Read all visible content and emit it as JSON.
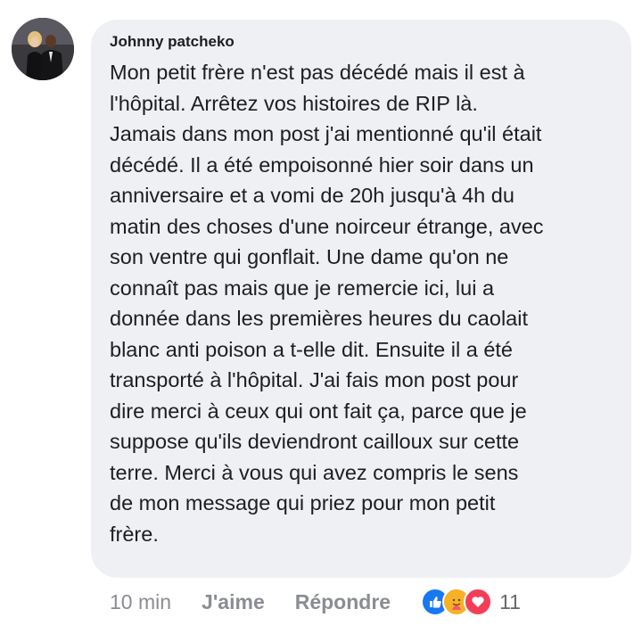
{
  "comment": {
    "author": "Johnny patcheko",
    "lines": [
      "Mon petit frère n'est pas décédé mais il est à",
      "l'hôpital. Arrêtez vos histoires de RIP là.",
      "Jamais dans mon post j'ai mentionné qu'il était",
      "décédé. Il a été empoisonné hier soir dans un",
      "anniversaire et a vomi de 20h jusqu'à 4h du",
      "matin des choses d'une noirceur étrange, avec",
      "son ventre qui gonflait. Une dame qu'on ne",
      "connaît pas mais que je remercie ici, lui a",
      "donnée dans les premières heures du caolait",
      "blanc anti poison a t-elle dit. Ensuite il a été",
      "transporté à l'hôpital. J'ai fais mon post pour",
      "dire merci à ceux qui ont fait ça, parce que je",
      "suppose qu'ils deviendront cailloux sur cette",
      "terre.  Merci à vous qui avez compris le sens",
      "de mon message qui priez pour mon petit",
      "frère."
    ]
  },
  "actions": {
    "time": "10 min",
    "like_label": "J'aime",
    "reply_label": "Répondre",
    "reaction_count": "11",
    "reactions": [
      "like-icon",
      "care-icon",
      "love-icon"
    ]
  },
  "colors": {
    "bubble": "#eff0f3",
    "text": "#1c1e21",
    "muted": "#8a8d91",
    "like_blue": "#1877f2",
    "love_red": "#f33e58",
    "care_yellow": "#f7b125"
  }
}
